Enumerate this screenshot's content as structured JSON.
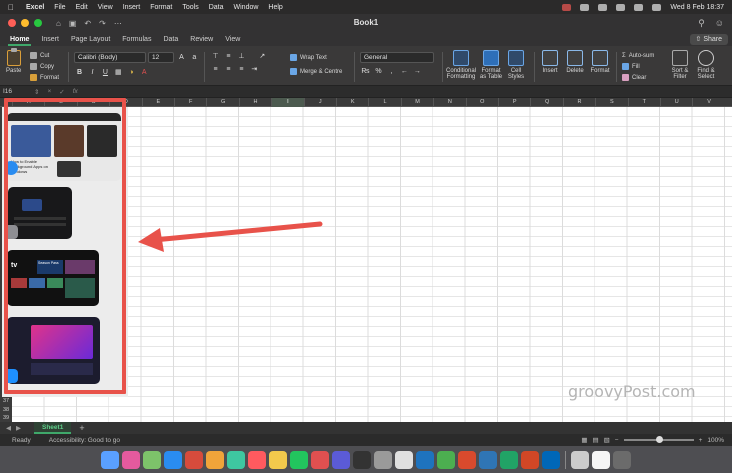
{
  "menubar": {
    "app_name": "Excel",
    "items": [
      "File",
      "Edit",
      "View",
      "Insert",
      "Format",
      "Tools",
      "Data",
      "Window",
      "Help"
    ],
    "clock": "Wed 8 Feb  18:37"
  },
  "window": {
    "title": "Book1"
  },
  "ribbon_tabs": [
    "Home",
    "Insert",
    "Page Layout",
    "Formulas",
    "Data",
    "Review",
    "View"
  ],
  "share_label": "Share",
  "clipboard": {
    "paste": "Paste",
    "cut": "Cut",
    "copy": "Copy",
    "format": "Format"
  },
  "font": {
    "name": "Calibri (Body)",
    "size": "12"
  },
  "alignment": {
    "wrap_text": "Wrap Text",
    "merge_centre": "Merge & Centre"
  },
  "number_format": {
    "value": "General"
  },
  "styles": {
    "conditional": [
      "Conditional",
      "Formatting"
    ],
    "format_table": [
      "Format",
      "as Table"
    ],
    "cell_styles": [
      "Cell",
      "Styles"
    ]
  },
  "cells": {
    "insert": "Insert",
    "delete": "Delete",
    "format": "Format"
  },
  "editing": {
    "autosum": "Auto-sum",
    "fill": "Fill",
    "clear": "Clear",
    "sort_filter": [
      "Sort &",
      "Filter"
    ],
    "find_select": [
      "Find &",
      "Select"
    ]
  },
  "formula_bar": {
    "name_box": "I16",
    "fx": "fx"
  },
  "columns": [
    "A",
    "B",
    "C",
    "D",
    "E",
    "F",
    "G",
    "H",
    "I",
    "J",
    "K",
    "L",
    "M",
    "N",
    "O",
    "P",
    "Q",
    "R",
    "S",
    "T",
    "U",
    "V"
  ],
  "selected_column": "I",
  "rows": [
    "37",
    "38",
    "39"
  ],
  "sheet_tab": "Sheet1",
  "status": {
    "ready": "Ready",
    "accessibility": "Accessibility: Good to go",
    "zoom": "100%"
  },
  "watermark": "groovyPost.com",
  "thumbs": {
    "t1_headline": "How to Enable Background Apps on Windows",
    "t3_tv": "tv",
    "t3_tagline": "Season Pass"
  },
  "dock_colors": [
    "#5aa0ff",
    "#e45a9e",
    "#7dc36a",
    "#2a8cf0",
    "#d64b3c",
    "#f0a43a",
    "#3ec7a0",
    "#ff5a5f",
    "#f2c94c",
    "#22c55e",
    "#e05050",
    "#5b5bd6",
    "#333333",
    "#9a9a9a",
    "#e0e0e0",
    "#1e73be",
    "#4caf50",
    "#d94a2d",
    "#2f75b5",
    "#21a366",
    "#d24726",
    "#0067b8",
    "#cccccc",
    "#f5f5f5",
    "#6b6b6b"
  ]
}
